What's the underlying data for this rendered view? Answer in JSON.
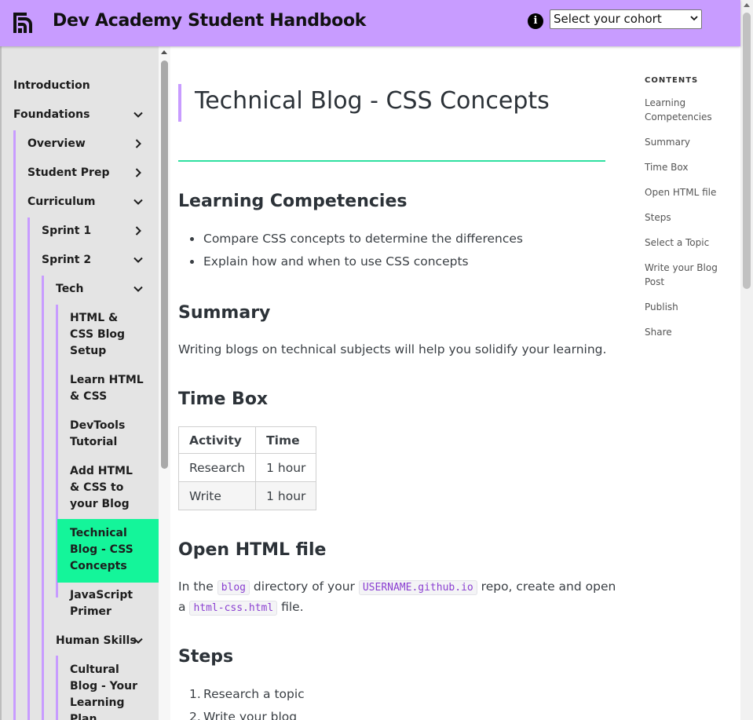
{
  "header": {
    "title": "Dev Academy Student Handbook",
    "cohort_select": "Select your cohort"
  },
  "sidebar": {
    "introduction": "Introduction",
    "foundations": "Foundations",
    "overview": "Overview",
    "student_prep": "Student Prep",
    "curriculum": "Curriculum",
    "sprint1": "Sprint 1",
    "sprint2": "Sprint 2",
    "tech": "Tech",
    "html_css_blog_setup": [
      "HTML &",
      "CSS Blog",
      "Setup"
    ],
    "learn_html_css": [
      "Learn HTML",
      "& CSS"
    ],
    "devtools_tutorial": [
      "DevTools",
      "Tutorial"
    ],
    "add_html_css": [
      "Add HTML",
      "& CSS to",
      "your Blog"
    ],
    "technical_blog": [
      "Technical",
      "Blog - CSS",
      "Concepts"
    ],
    "javascript_primer": [
      "JavaScript",
      "Primer"
    ],
    "human_skills": "Human Skills",
    "cultural_blog": [
      "Cultural",
      "Blog - Your",
      "Learning",
      "Plan"
    ]
  },
  "main": {
    "title": "Technical Blog - CSS Concepts",
    "learning": {
      "heading": "Learning Competencies",
      "items": [
        "Compare CSS concepts to determine the differences",
        "Explain how and when to use CSS concepts"
      ]
    },
    "summary": {
      "heading": "Summary",
      "text": "Writing blogs on technical subjects will help you solidify your learning."
    },
    "timebox": {
      "heading": "Time Box",
      "headers": [
        "Activity",
        "Time"
      ],
      "rows": [
        [
          "Research",
          "1 hour"
        ],
        [
          "Write",
          "1 hour"
        ]
      ]
    },
    "open_html": {
      "heading": "Open HTML file",
      "t1": "In the ",
      "code1": "blog",
      "t2": " directory of your ",
      "code2": "USERNAME.github.io",
      "t3": " repo, create and open",
      "t4": "a ",
      "code3": "html-css.html",
      "t5": " file."
    },
    "steps": {
      "heading": "Steps",
      "items": [
        "Research a topic",
        "Write your blog"
      ]
    }
  },
  "toc": {
    "heading": "CONTENTS",
    "items": [
      [
        "Learning",
        "Competencies"
      ],
      [
        "Summary"
      ],
      [
        "Time Box"
      ],
      [
        "Open HTML file"
      ],
      [
        "Steps"
      ],
      [
        "Select a Topic"
      ],
      [
        "Write your Blog",
        "Post"
      ],
      [
        "Publish"
      ],
      [
        "Share"
      ]
    ]
  }
}
